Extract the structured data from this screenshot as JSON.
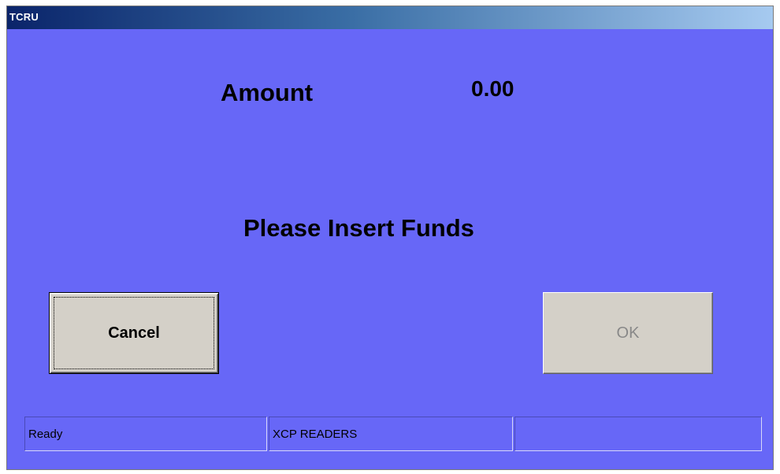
{
  "window": {
    "title": "TCRU"
  },
  "main": {
    "amount_label": "Amount",
    "amount_value": "0.00",
    "message": "Please Insert Funds"
  },
  "buttons": {
    "cancel_label": "Cancel",
    "ok_label": "OK"
  },
  "statusbar": {
    "panels": [
      "Ready",
      "XCP READERS",
      ""
    ]
  },
  "colors": {
    "client_background": "#6767f7",
    "titlebar_start": "#0a246a",
    "titlebar_end": "#a6caf0",
    "button_face": "#d4d0c8",
    "disabled_text": "#888888"
  }
}
